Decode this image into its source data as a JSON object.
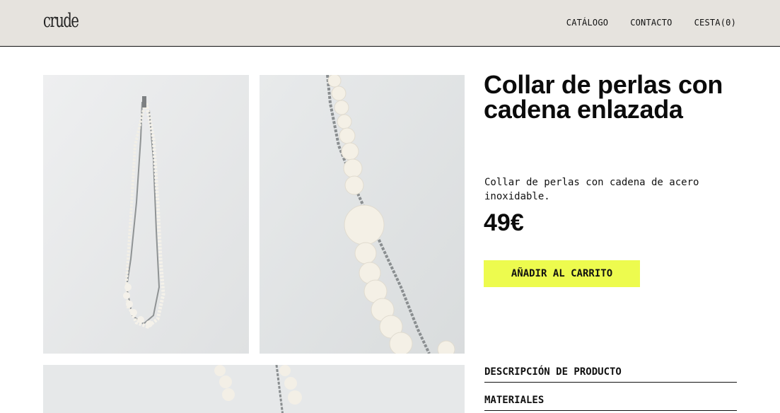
{
  "header": {
    "logo": "crude",
    "nav": {
      "catalog": "CATÁLOGO",
      "contact": "CONTACTO",
      "cart": "CESTA(0)"
    }
  },
  "product": {
    "title": "Collar de perlas con cadena enlazada",
    "description": "Collar de perlas con cadena de acero inoxidable.",
    "price": "49€",
    "add_to_cart": "AÑADIR AL CARRITO",
    "sections": [
      "DESCRIPCIÓN DE PRODUCTO",
      "MATERIALES"
    ]
  },
  "colors": {
    "header_bg": "#e6e3de",
    "button_bg": "#edfb4e",
    "text": "#111111"
  },
  "icons": {
    "gallery": [
      "necklace-photo-full",
      "necklace-photo-closeup",
      "necklace-photo-detail"
    ]
  }
}
